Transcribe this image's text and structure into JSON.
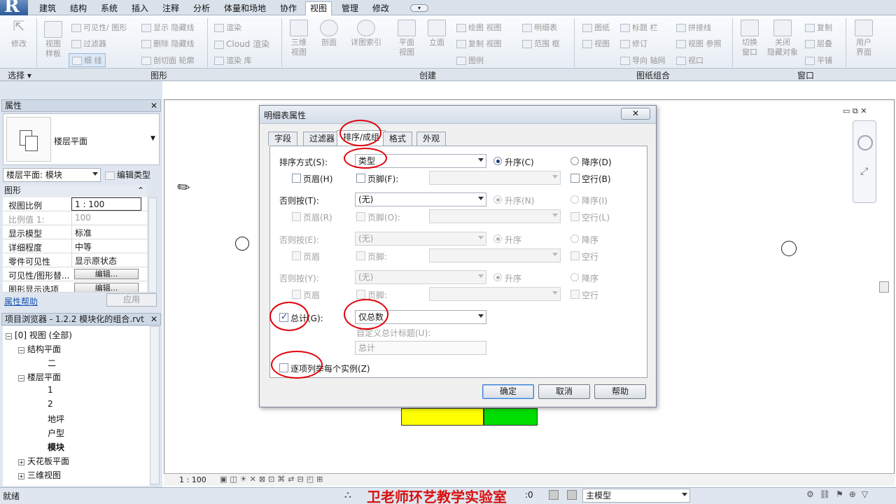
{
  "ribbon": {
    "tabs": [
      "建筑",
      "结构",
      "系统",
      "插入",
      "注释",
      "分析",
      "体量和场地",
      "协作",
      "视图",
      "管理",
      "修改"
    ],
    "active_tab": "视图",
    "groups": {
      "select": "选择",
      "graphics": "图形",
      "create": "创建",
      "sheet": "图纸组合",
      "window": "窗口"
    },
    "buttons": {
      "modify": "修改",
      "view_template": "视图\n样板",
      "visibility": "可见性/ 图形",
      "filters": "过滤器",
      "thin_lines": "细 线",
      "show_hidden": "显示 隐藏线",
      "remove_hidden": "删除 隐藏线",
      "cut_profile": "剖切面 轮廓",
      "render": "渲染",
      "cloud_render": "Cloud  渲染",
      "render_gallery": "渲染  库",
      "3d_view": "三维\n视图",
      "section": "剖面",
      "callout": "详图索引",
      "plan_view": "平面\n视图",
      "elevation": "立面",
      "drafting_view": "绘图 视图",
      "duplicate_view": "复制 视图",
      "legends": "图例",
      "schedules": "明细表",
      "scope_box": "范围 框",
      "sheet": "图纸",
      "view": "视图",
      "title_block": "标题 栏",
      "revisions": "修订",
      "guide_grid": "导向 轴网",
      "matchline": "拼接线",
      "view_reference": "视图 参照",
      "viewports": "视口",
      "switch_windows": "切换\n窗口",
      "close_hidden": "关闭\n隐藏对象",
      "replicate": "复制",
      "cascade": "层叠",
      "tile": "平铺",
      "user_interface": "用户\n界面"
    }
  },
  "properties": {
    "header": "属性",
    "type_name": "楼层平面",
    "selector": "楼层平面: 模块",
    "edit_type": "编辑类型",
    "section": "图形",
    "rows": [
      {
        "k": "视图比例",
        "v": "1 : 100"
      },
      {
        "k": "比例值 1:",
        "v": "100"
      },
      {
        "k": "显示模型",
        "v": "标准"
      },
      {
        "k": "详细程度",
        "v": "中等"
      },
      {
        "k": "零件可见性",
        "v": "显示原状态"
      },
      {
        "k": "可见性/图形替...",
        "v": "编辑..."
      },
      {
        "k": "图形显示选项",
        "v": "编辑..."
      }
    ],
    "help": "属性帮助",
    "apply": "应用"
  },
  "browser": {
    "header": "项目浏览器 - 1.2.2 模块化的组合.rvt",
    "items": [
      {
        "label": "[0] 视图 (全部)"
      },
      {
        "label": "结构平面"
      },
      {
        "label": "二"
      },
      {
        "label": "楼层平面"
      },
      {
        "label": "1"
      },
      {
        "label": "2"
      },
      {
        "label": "地坪"
      },
      {
        "label": "户型"
      },
      {
        "label": "模块"
      },
      {
        "label": "天花板平面"
      },
      {
        "label": "三维视图"
      }
    ]
  },
  "dialog": {
    "title": "明细表属性",
    "tabs": [
      "字段",
      "过滤器",
      "排序/成组",
      "格式",
      "外观"
    ],
    "active_tab": "排序/成组",
    "sort_by": {
      "label": "排序方式(S):",
      "value": "类型",
      "asc": "升序(C)",
      "desc": "降序(D)",
      "header": "页眉(H)",
      "footer": "页脚(F):",
      "blank": "空行(B)"
    },
    "then_by_1": {
      "label": "否则按(T):",
      "value": "(无)",
      "asc": "升序(N)",
      "desc": "降序(I)",
      "header": "页眉(R)",
      "footer": "页脚(O):",
      "blank": "空行(L)"
    },
    "then_by_2": {
      "label": "否则按(E):",
      "value": "(无)",
      "asc": "升序",
      "desc": "降序",
      "header": "页眉",
      "footer": "页脚:",
      "blank": "空行"
    },
    "then_by_3": {
      "label": "否则按(Y):",
      "value": "(无)",
      "asc": "升序",
      "desc": "降序",
      "header": "页眉",
      "footer": "页脚:",
      "blank": "空行"
    },
    "grand_totals": {
      "label": "总计(G):",
      "value": "仅总数",
      "custom_title_label": "自定义总计标题(U):",
      "custom_title": "总计"
    },
    "itemize": "逐项列举每个实例(Z)",
    "ok": "确定",
    "cancel": "取消",
    "help": "帮助",
    "close": "✕"
  },
  "viewbar": {
    "scale": "1 : 100"
  },
  "status": {
    "left": "就绪",
    "zero": ":0",
    "model": "主模型",
    "watermark": "卫老师环艺教学实验室"
  },
  "colors": {
    "yellow": "#ffff00",
    "green": "#00dd00",
    "red_annotation": "#e0000a"
  }
}
